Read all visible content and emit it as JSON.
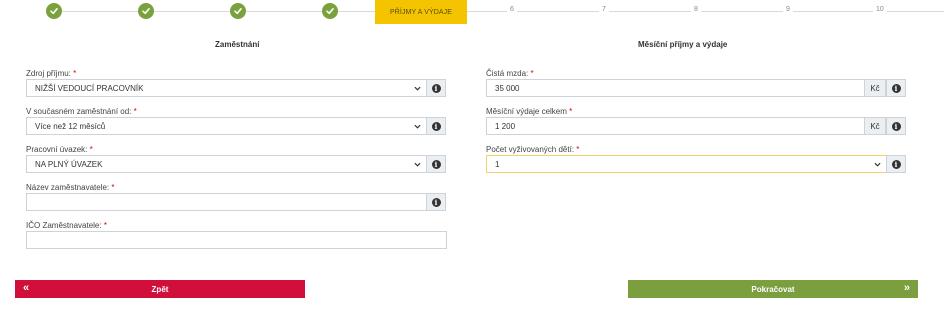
{
  "stepper": {
    "active_label": "PŘÍJMY A VÝDAJE",
    "pending": [
      "6",
      "7",
      "8",
      "9",
      "10"
    ]
  },
  "left": {
    "title": "Zaměstnání",
    "fields": [
      {
        "label": "Zdroj příjmu:",
        "required": "*",
        "value": "NIŽŠÍ VEDOUCÍ PRACOVNÍK"
      },
      {
        "label": "V současném zaměstnání od:",
        "required": "*",
        "value": "Více než 12 měsíců"
      },
      {
        "label": "Pracovní úvazek:",
        "required": "*",
        "value": "NA PLNÝ ÚVAZEK"
      },
      {
        "label": "Název zaměstnavatele:",
        "required": "*",
        "value": ""
      },
      {
        "label": "IČO Zaměstnavatele:",
        "required": "*",
        "value": ""
      }
    ]
  },
  "right": {
    "title": "Měsíční příjmy a výdaje",
    "fields": [
      {
        "label": "Čistá mzda:",
        "required": "*",
        "value": "35 000",
        "unit": "Kč"
      },
      {
        "label": "Měsíční výdaje celkem",
        "required": "*",
        "value": "1 200",
        "unit": "Kč"
      },
      {
        "label": "Počet vyživovaných dětí:",
        "required": "*",
        "value": "1"
      }
    ]
  },
  "buttons": {
    "back": "Zpět",
    "back_arrow": "«",
    "next": "Pokračovat",
    "next_arrow": "»"
  },
  "colors": {
    "done": "#7aa23c",
    "active": "#f5c400",
    "back": "#d20f3a",
    "next": "#7b9e3f"
  }
}
